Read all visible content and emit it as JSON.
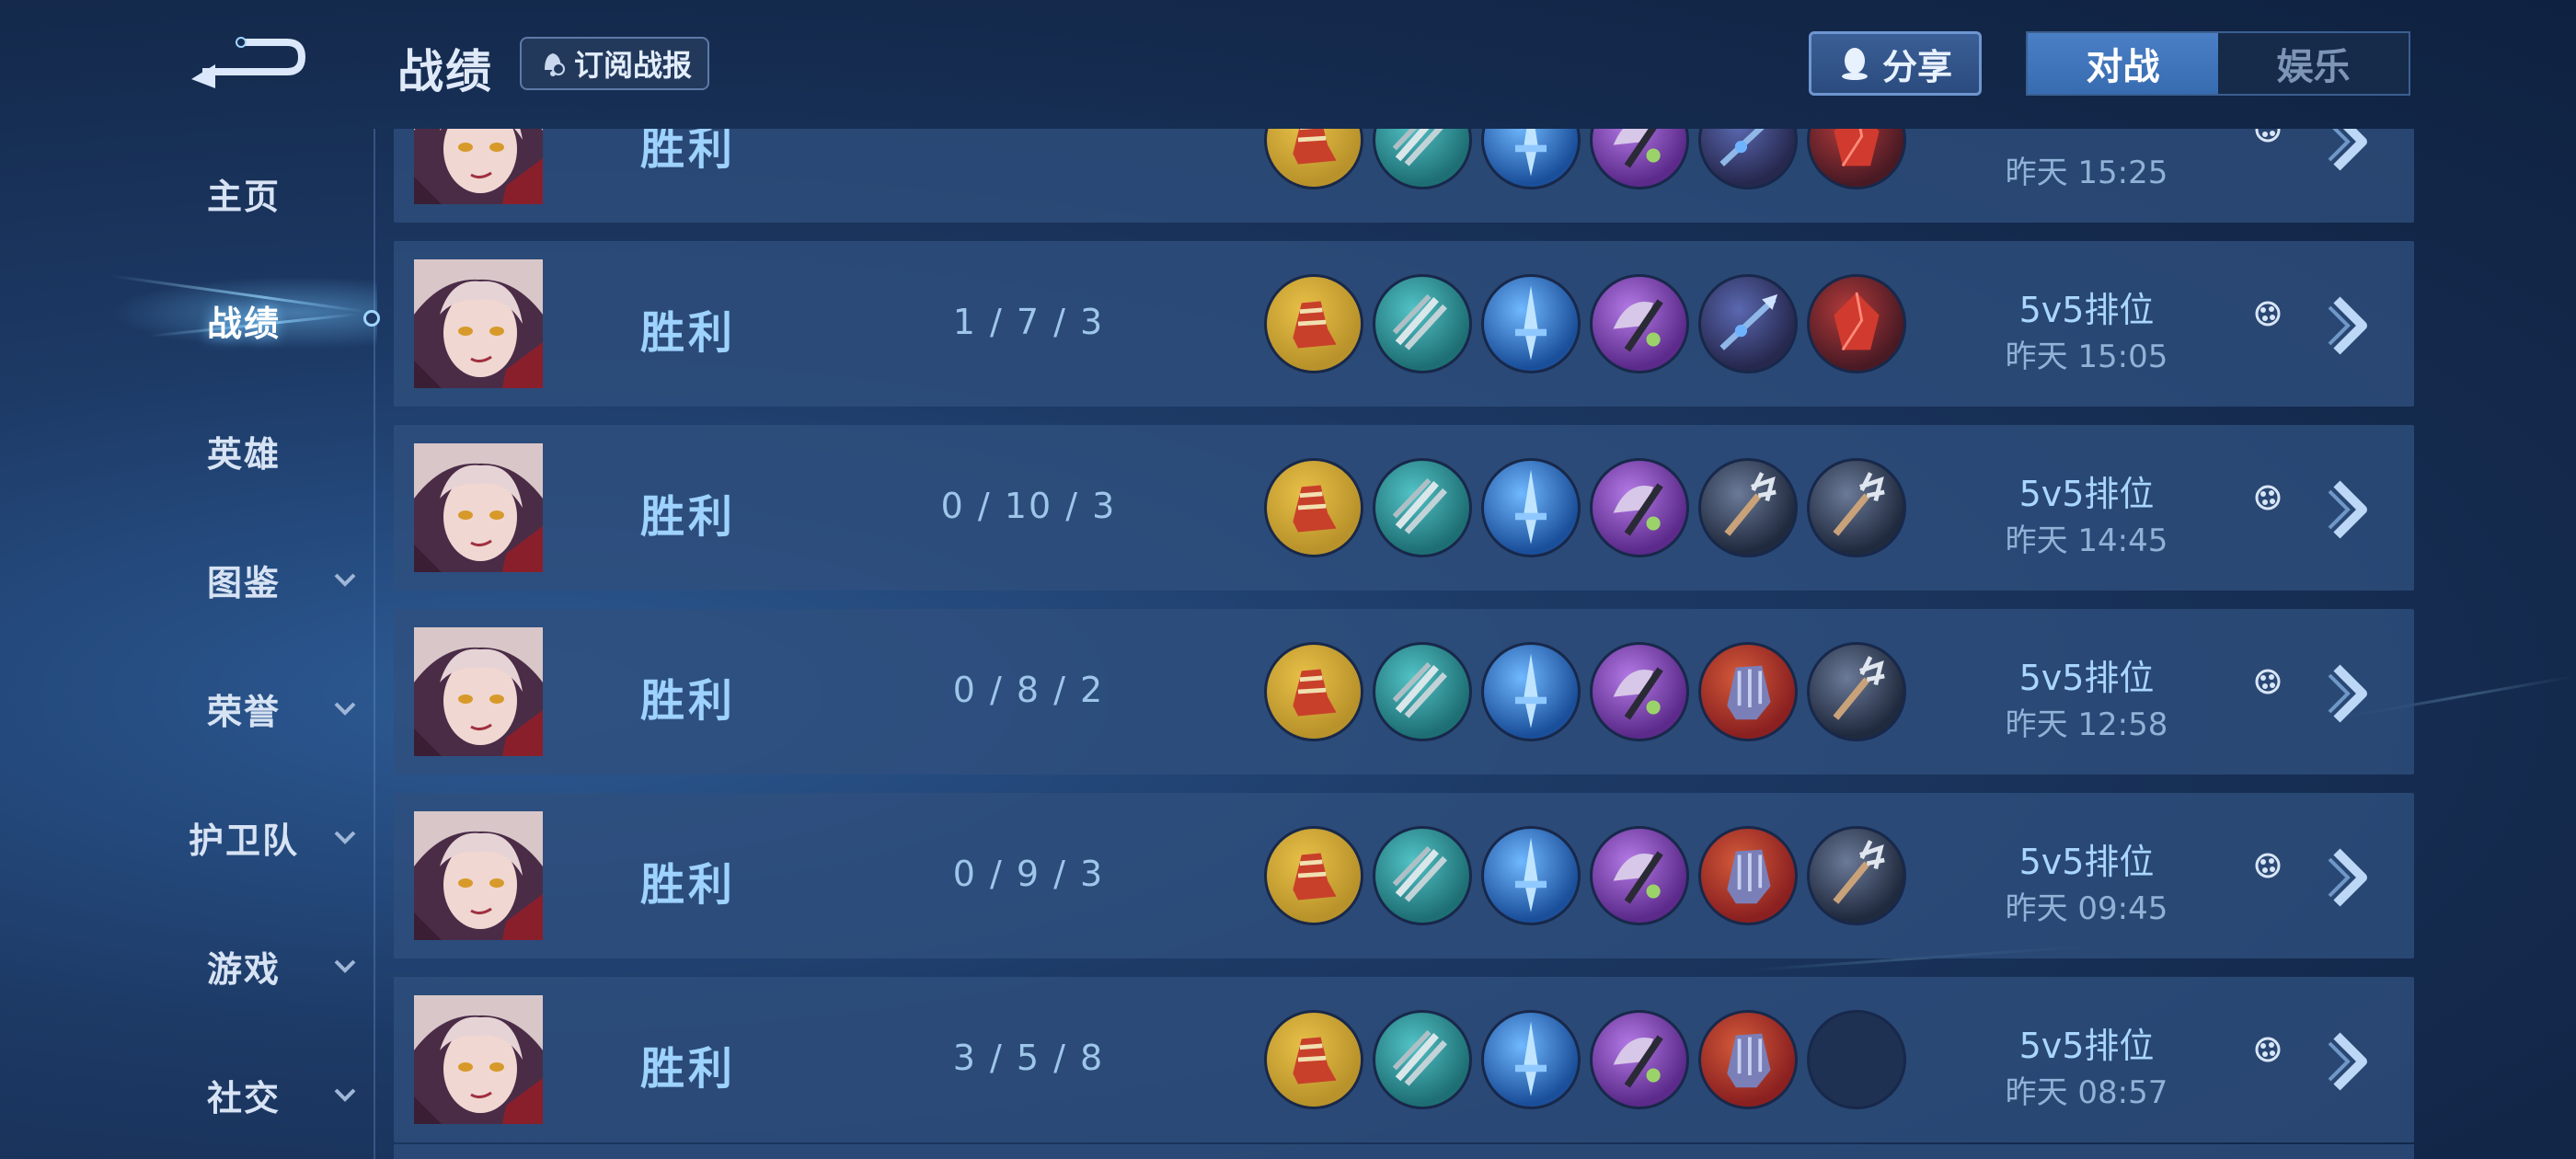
{
  "header": {
    "title": "战绩",
    "subscribe_label": "订阅战报",
    "share_label": "分享",
    "tabs": [
      {
        "label": "对战",
        "active": true
      },
      {
        "label": "娱乐",
        "active": false
      }
    ]
  },
  "sidebar": {
    "items": [
      {
        "label": "主页",
        "expandable": false
      },
      {
        "label": "战绩",
        "expandable": false,
        "active": true
      },
      {
        "label": "英雄",
        "expandable": false
      },
      {
        "label": "图鉴",
        "expandable": true
      },
      {
        "label": "荣誉",
        "expandable": true
      },
      {
        "label": "护卫队",
        "expandable": true
      },
      {
        "label": "游戏",
        "expandable": true
      },
      {
        "label": "社交",
        "expandable": true
      }
    ]
  },
  "colors": {
    "accent": "#4a7fc5",
    "result_text": "#9ed2ff",
    "row_bg": "#30507d"
  },
  "matches": [
    {
      "result": "胜利",
      "kda": "",
      "mode": "",
      "time": "昨天 15:25",
      "items": [
        "boots-gold",
        "claw-teal",
        "sword-blue",
        "axe-purple",
        "spear-dark",
        "gem-red"
      ]
    },
    {
      "result": "胜利",
      "kda": "1 / 7 / 3",
      "mode": "5v5排位",
      "time": "昨天 15:05",
      "items": [
        "boots-gold",
        "claw-teal",
        "sword-blue",
        "axe-purple",
        "spear-dark",
        "gem-red"
      ]
    },
    {
      "result": "胜利",
      "kda": "0 / 10 / 3",
      "mode": "5v5排位",
      "time": "昨天 14:45",
      "items": [
        "boots-gold",
        "claw-teal",
        "sword-blue",
        "axe-purple",
        "trident-dark",
        "trident-dark"
      ]
    },
    {
      "result": "胜利",
      "kda": "0 / 8 / 2",
      "mode": "5v5排位",
      "time": "昨天 12:58",
      "items": [
        "boots-gold",
        "claw-teal",
        "sword-blue",
        "axe-purple",
        "gauntlet-red",
        "trident-dark"
      ]
    },
    {
      "result": "胜利",
      "kda": "0 / 9 / 3",
      "mode": "5v5排位",
      "time": "昨天 09:45",
      "items": [
        "boots-gold",
        "claw-teal",
        "sword-blue",
        "axe-purple",
        "gauntlet-red",
        "trident-dark"
      ]
    },
    {
      "result": "胜利",
      "kda": "3 / 5 / 8",
      "mode": "5v5排位",
      "time": "昨天 08:57",
      "items": [
        "boots-gold",
        "claw-teal",
        "sword-blue",
        "axe-purple",
        "gauntlet-red",
        "empty-slot"
      ]
    }
  ]
}
